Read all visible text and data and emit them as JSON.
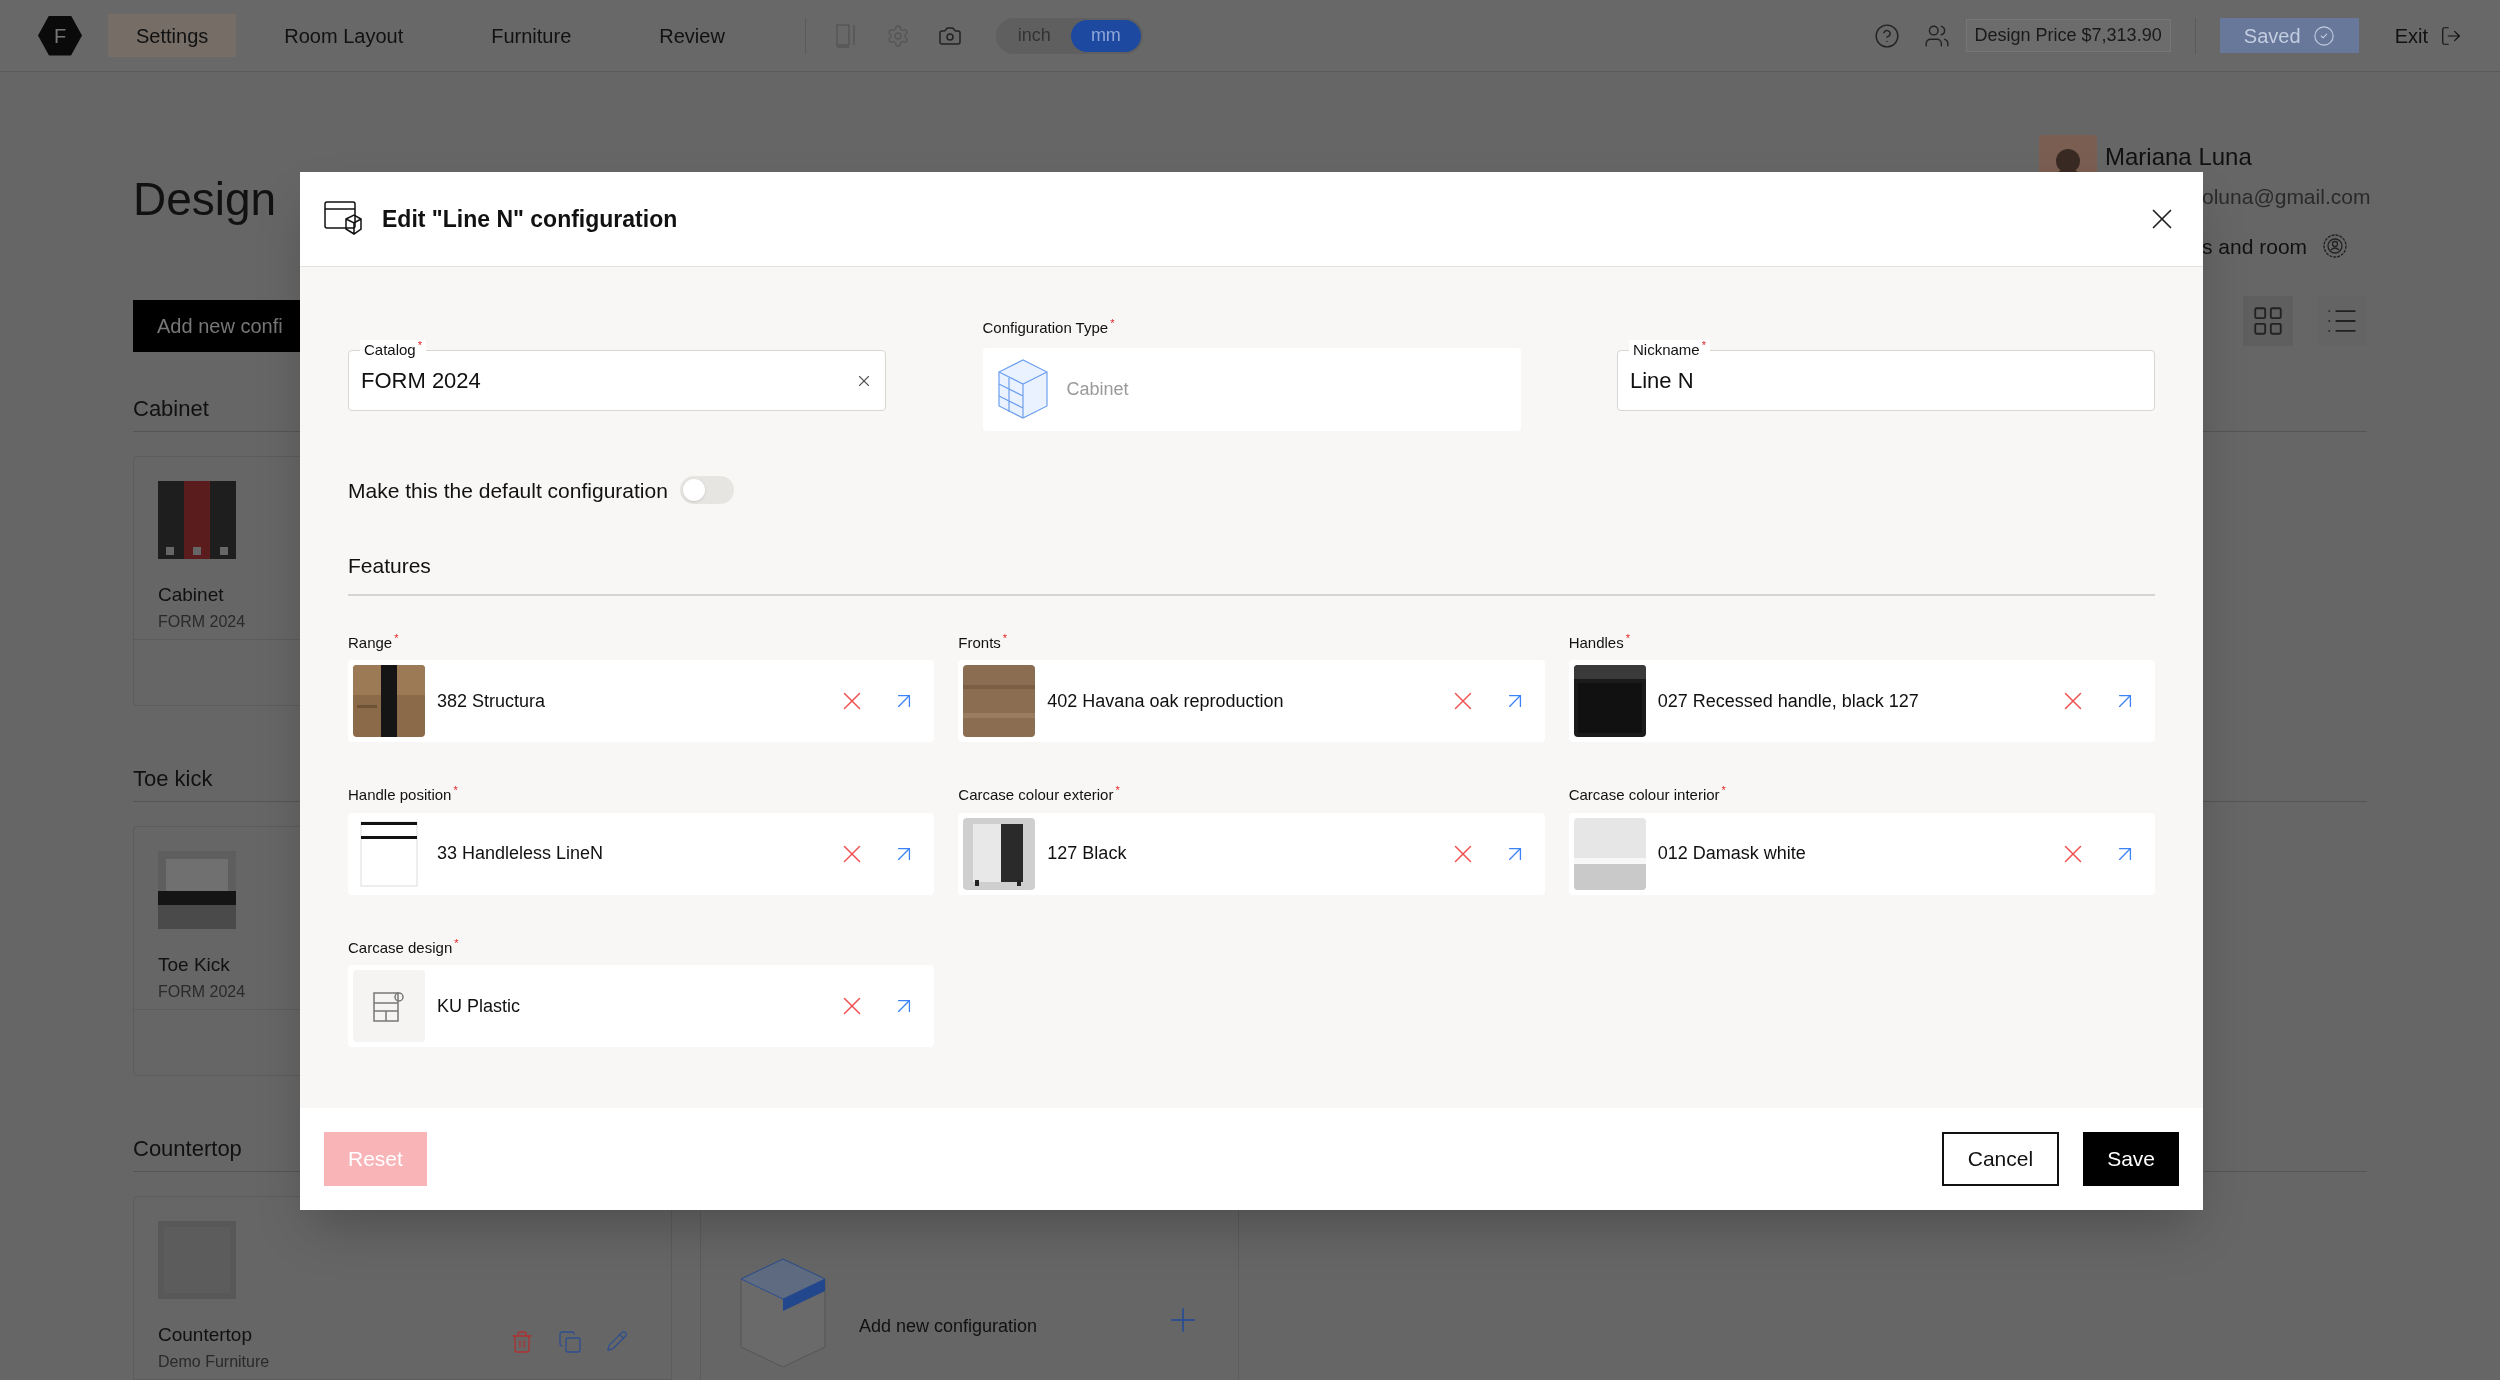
{
  "top_bar": {
    "logo": "F",
    "tabs": [
      {
        "label": "Settings",
        "selected": true
      },
      {
        "label": "Room Layout",
        "selected": false
      },
      {
        "label": "Furniture",
        "selected": false
      },
      {
        "label": "Review",
        "selected": false
      }
    ],
    "units": [
      {
        "label": "inch",
        "selected": false
      },
      {
        "label": "mm",
        "selected": true
      }
    ],
    "design_price": "Design Price $7,313.90",
    "saved_button": {
      "label": "Saved",
      "disabled": true
    },
    "exit": "Exit"
  },
  "page": {
    "title": "Design",
    "add_button": "Add new confi",
    "user": {
      "name": "Mariana Luna",
      "email": "oluna@gmail.com",
      "link": "s and room"
    },
    "sections": [
      {
        "heading": "Cabinet",
        "card": {
          "name": "Cabinet",
          "catalog": "FORM 2024"
        }
      },
      {
        "heading": "Toe kick",
        "card": {
          "name": "Toe Kick",
          "catalog": "FORM 2024"
        }
      },
      {
        "heading": "Countertop",
        "card": {
          "name": "Countertop",
          "catalog": "Demo Furniture"
        },
        "add_card": "Add new configuration"
      }
    ]
  },
  "dialog": {
    "title": "Edit \"Line N\" configuration",
    "fields": [
      {
        "kind": "select",
        "label": "Catalog",
        "mark": "*",
        "value": "FORM 2024"
      },
      {
        "kind": "type",
        "label": "Configuration Type",
        "mark": "*",
        "value": "Cabinet",
        "disabled": true
      },
      {
        "kind": "text",
        "label": "Nickname",
        "mark": "*",
        "value": "Line N"
      }
    ],
    "default_toggle": {
      "label": "Make this the default configuration",
      "on": false
    },
    "features_heading": "Features",
    "features": [
      {
        "label": "Range",
        "mark": "*",
        "value": "382 Structura",
        "kind": "picture"
      },
      {
        "label": "Fronts",
        "mark": "*",
        "value": "402 Havana oak reproduction",
        "kind": "picture"
      },
      {
        "label": "Handles",
        "mark": "*",
        "value": "027 Recessed handle, black 127",
        "kind": "picture"
      },
      {
        "label": "Handle position",
        "mark": "*",
        "value": "33 Handleless LineN",
        "kind": "lines"
      },
      {
        "label": "Carcase colour exterior",
        "mark": "*",
        "value": "127 Black",
        "kind": "picture"
      },
      {
        "label": "Carcase colour interior",
        "mark": "*",
        "value": "012 Damask white",
        "kind": "picture"
      },
      {
        "label": "Carcase design",
        "mark": "*",
        "value": "KU Plastic",
        "kind": "icon"
      }
    ],
    "buttons": [
      {
        "label": "Reset",
        "kind": "reset",
        "disabled": true
      },
      {
        "label": "Cancel",
        "kind": "secondary"
      },
      {
        "label": "Save",
        "kind": "primary"
      }
    ]
  }
}
